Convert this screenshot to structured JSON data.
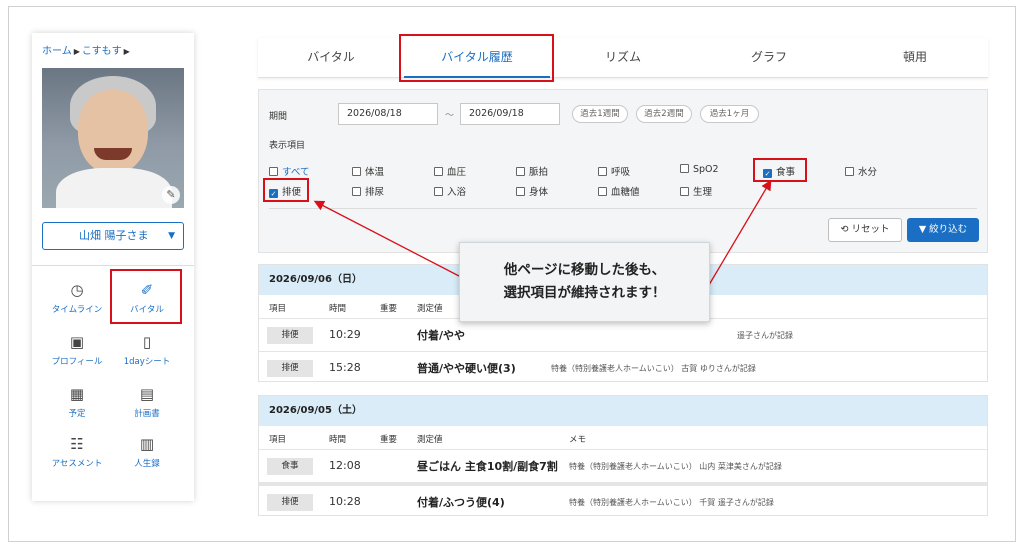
{
  "breadcrumb": {
    "home": "ホーム",
    "current": "こすもす"
  },
  "resident": {
    "name": "山畑 陽子さま"
  },
  "sidenav": [
    {
      "label": "タイムライン",
      "icon": "clock-icon"
    },
    {
      "label": "バイタル",
      "icon": "thermometer-icon"
    },
    {
      "label": "プロフィール",
      "icon": "id-card-icon"
    },
    {
      "label": "1dayシート",
      "icon": "clipboard-icon"
    },
    {
      "label": "予定",
      "icon": "calendar-icon"
    },
    {
      "label": "計画書",
      "icon": "badge-clipboard-icon"
    },
    {
      "label": "アセスメント",
      "icon": "checklist-icon"
    },
    {
      "label": "人生録",
      "icon": "book-icon"
    }
  ],
  "tabs": [
    "バイタル",
    "バイタル履歴",
    "リズム",
    "グラフ",
    "頓用"
  ],
  "active_tab": "バイタル履歴",
  "filter": {
    "period_label": "期間",
    "date_from": "2026/08/18",
    "date_to": "2026/09/18",
    "range_sep": "～",
    "quick_ranges": [
      "過去1週間",
      "過去2週間",
      "過去1ヶ月"
    ],
    "display_label": "表示項目",
    "items": [
      {
        "label": "すべて",
        "checked": false
      },
      {
        "label": "体温",
        "checked": false
      },
      {
        "label": "血圧",
        "checked": false
      },
      {
        "label": "脈拍",
        "checked": false
      },
      {
        "label": "呼吸",
        "checked": false
      },
      {
        "label": "SpO2",
        "checked": false
      },
      {
        "label": "食事",
        "checked": true
      },
      {
        "label": "水分",
        "checked": false
      },
      {
        "label": "排便",
        "checked": true
      },
      {
        "label": "排尿",
        "checked": false
      },
      {
        "label": "入浴",
        "checked": false
      },
      {
        "label": "身体",
        "checked": false
      },
      {
        "label": "血糖値",
        "checked": false
      },
      {
        "label": "生理",
        "checked": false
      }
    ],
    "reset_label": "リセット",
    "apply_label": "絞り込む"
  },
  "columns": {
    "item": "項目",
    "time": "時間",
    "important": "重要",
    "value": "測定値",
    "memo": "メモ"
  },
  "days": [
    {
      "date": "2026/09/06（日）",
      "rows": [
        {
          "item": "排便",
          "time": "10:29",
          "value": "付着/やや",
          "memo": "遥子さんが記録"
        },
        {
          "item": "排便",
          "time": "15:28",
          "value": "普通/やや硬い便(3)",
          "memo": "特養（特別養護老人ホームいこい） 古賀 ゆりさんが記録"
        }
      ]
    },
    {
      "date": "2026/09/05（土）",
      "rows": [
        {
          "item": "食事",
          "time": "12:08",
          "value": "昼ごはん 主食10割/副食7割",
          "memo": "特養（特別養護老人ホームいこい） 山内 菜津美さんが記録"
        },
        {
          "item": "排便",
          "time": "10:28",
          "value": "付着/ふつう便(4)",
          "memo": "特養（特別養護老人ホームいこい） 千賀 遥子さんが記録"
        }
      ]
    }
  ],
  "callout": {
    "line1": "他ページに移動した後も、",
    "line2": "選択項目が維持されます！"
  },
  "colors": {
    "accent": "#1a6fc4",
    "highlight": "#d8101a",
    "day_header": "#d9ecf8"
  }
}
